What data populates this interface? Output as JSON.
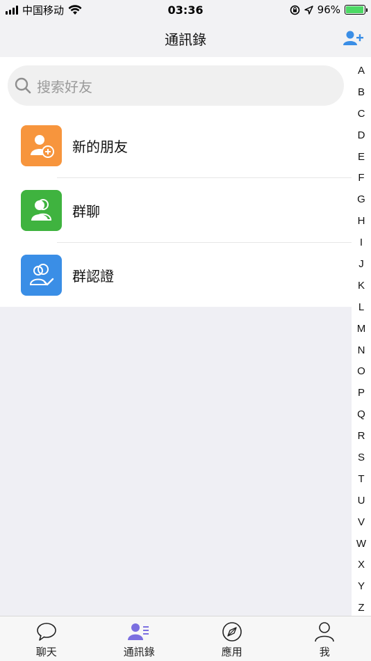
{
  "status_bar": {
    "carrier": "中国移动",
    "time": "03:36",
    "battery_percent": "96%",
    "battery_level": 0.96,
    "battery_color": "#4cd964"
  },
  "nav": {
    "title": "通訊錄",
    "add_icon": "add-contact-icon",
    "accent_color": "#3a8ee6"
  },
  "search": {
    "placeholder": "搜索好友"
  },
  "list": [
    {
      "label": "新的朋友",
      "icon": "new-friend-icon",
      "color": "#f7953d"
    },
    {
      "label": "群聊",
      "icon": "group-chat-icon",
      "color": "#3fb33f"
    },
    {
      "label": "群認證",
      "icon": "group-verify-icon",
      "color": "#3a8ee6"
    }
  ],
  "index_letters": [
    "A",
    "B",
    "C",
    "D",
    "E",
    "F",
    "G",
    "H",
    "I",
    "J",
    "K",
    "L",
    "M",
    "N",
    "O",
    "P",
    "Q",
    "R",
    "S",
    "T",
    "U",
    "V",
    "W",
    "X",
    "Y",
    "Z"
  ],
  "tabs": [
    {
      "label": "聊天",
      "icon": "chat-bubble-icon",
      "active": false
    },
    {
      "label": "通訊錄",
      "icon": "contacts-icon",
      "active": true
    },
    {
      "label": "應用",
      "icon": "compass-icon",
      "active": false
    },
    {
      "label": "我",
      "icon": "profile-icon",
      "active": false
    }
  ]
}
